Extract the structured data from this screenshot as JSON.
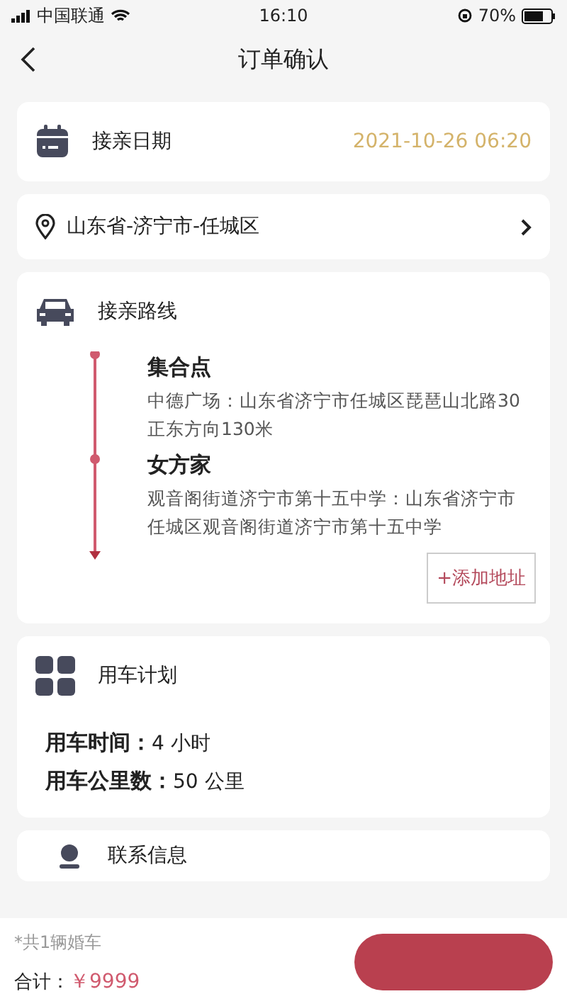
{
  "status_bar": {
    "carrier": "中国联通",
    "time": "16:10",
    "battery": "70%"
  },
  "nav": {
    "title": "订单确认"
  },
  "date_card": {
    "label": "接亲日期",
    "value": "2021-10-26 06:20"
  },
  "region": {
    "value": "山东省-济宁市-任城区"
  },
  "route": {
    "title": "接亲路线",
    "stops": [
      {
        "name": "集合点",
        "address": "中德广场：山东省济宁市任城区琵琶山北路30正东方向130米"
      },
      {
        "name": "女方家",
        "address": "观音阁街道济宁市第十五中学：山东省济宁市任城区观音阁街道济宁市第十五中学"
      }
    ],
    "add_button": "+添加地址"
  },
  "plan": {
    "title": "用车计划",
    "rows": [
      {
        "label": "用车时间：",
        "value": "4 小时"
      },
      {
        "label": "用车公里数：",
        "value": "50 公里"
      }
    ]
  },
  "contact": {
    "title": "联系信息"
  },
  "footer": {
    "note": "*共1辆婚车",
    "total_label": "合计：",
    "total": "￥9999"
  }
}
